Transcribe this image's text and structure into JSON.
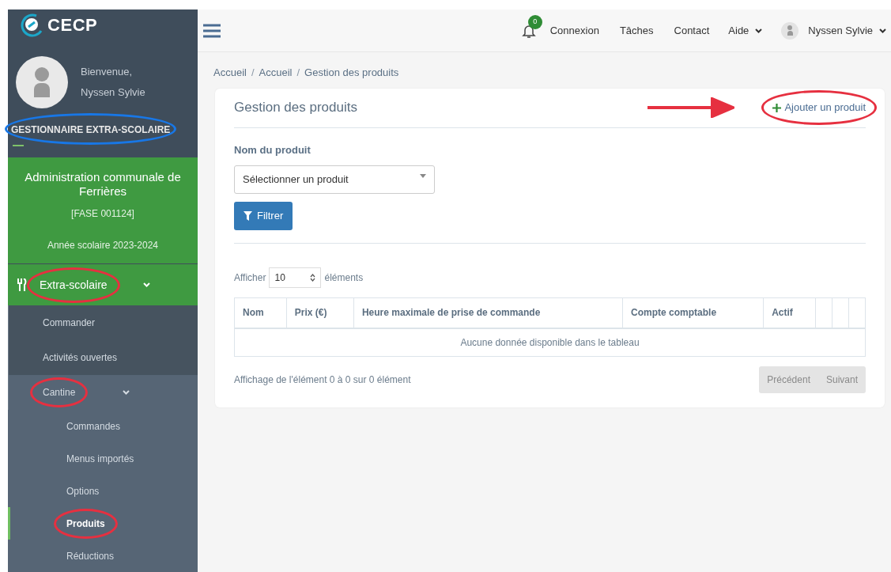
{
  "logo": {
    "text": "CECP"
  },
  "profile": {
    "greeting": "Bienvenue,",
    "name": "Nyssen Sylvie",
    "role": "GESTIONNAIRE EXTRA-SCOLAIRE",
    "role_circled": true
  },
  "organisation": {
    "name": "Administration communale de Ferrières",
    "code": "[FASE 001124]",
    "school_year": "Année scolaire 2023-2024"
  },
  "sidebar": {
    "items": [
      {
        "label": "Extra-scolaire",
        "expanded": true,
        "circled": true,
        "children": [
          {
            "label": "Commander",
            "circled": false,
            "selected": false
          },
          {
            "label": "Activités ouvertes",
            "circled": false,
            "selected": false
          },
          {
            "label": "Cantine",
            "expanded": true,
            "circled": true,
            "selected": false,
            "children": [
              {
                "label": "Commandes",
                "circled": false,
                "selected": false
              },
              {
                "label": "Menus importés",
                "circled": false,
                "selected": false
              },
              {
                "label": "Options",
                "circled": false,
                "selected": false
              },
              {
                "label": "Produits",
                "circled": true,
                "selected": true
              },
              {
                "label": "Réductions",
                "circled": false,
                "selected": false
              }
            ]
          }
        ]
      }
    ]
  },
  "topbar": {
    "notifications": "0",
    "links": [
      "Connexion",
      "Tâches",
      "Contact"
    ],
    "help": "Aide",
    "user": "Nyssen Sylvie"
  },
  "breadcrumb": [
    "Accueil",
    "Accueil",
    "Gestion des produits"
  ],
  "breadcrumb_separator": "/",
  "card": {
    "title": "Gestion des produits",
    "add_button": "Ajouter un produit",
    "add_circled": true,
    "pointer_arrow": true,
    "filter_label": "Nom du produit",
    "select_placeholder": "Sélectionner un produit",
    "filter_button": "Filtrer",
    "show_before": "Afficher",
    "page_size": "10",
    "show_after": "éléments"
  },
  "table": {
    "columns": [
      "Nom",
      "Prix (€)",
      "Heure maximale de prise de commande",
      "Compte comptable",
      "Actif",
      "",
      "",
      ""
    ],
    "empty": "Aucune donnée disponible dans le tableau"
  },
  "footer": {
    "info": "Affichage de l'élément 0 à 0 sur 0 élément",
    "prev": "Précédent",
    "next": "Suivant"
  }
}
